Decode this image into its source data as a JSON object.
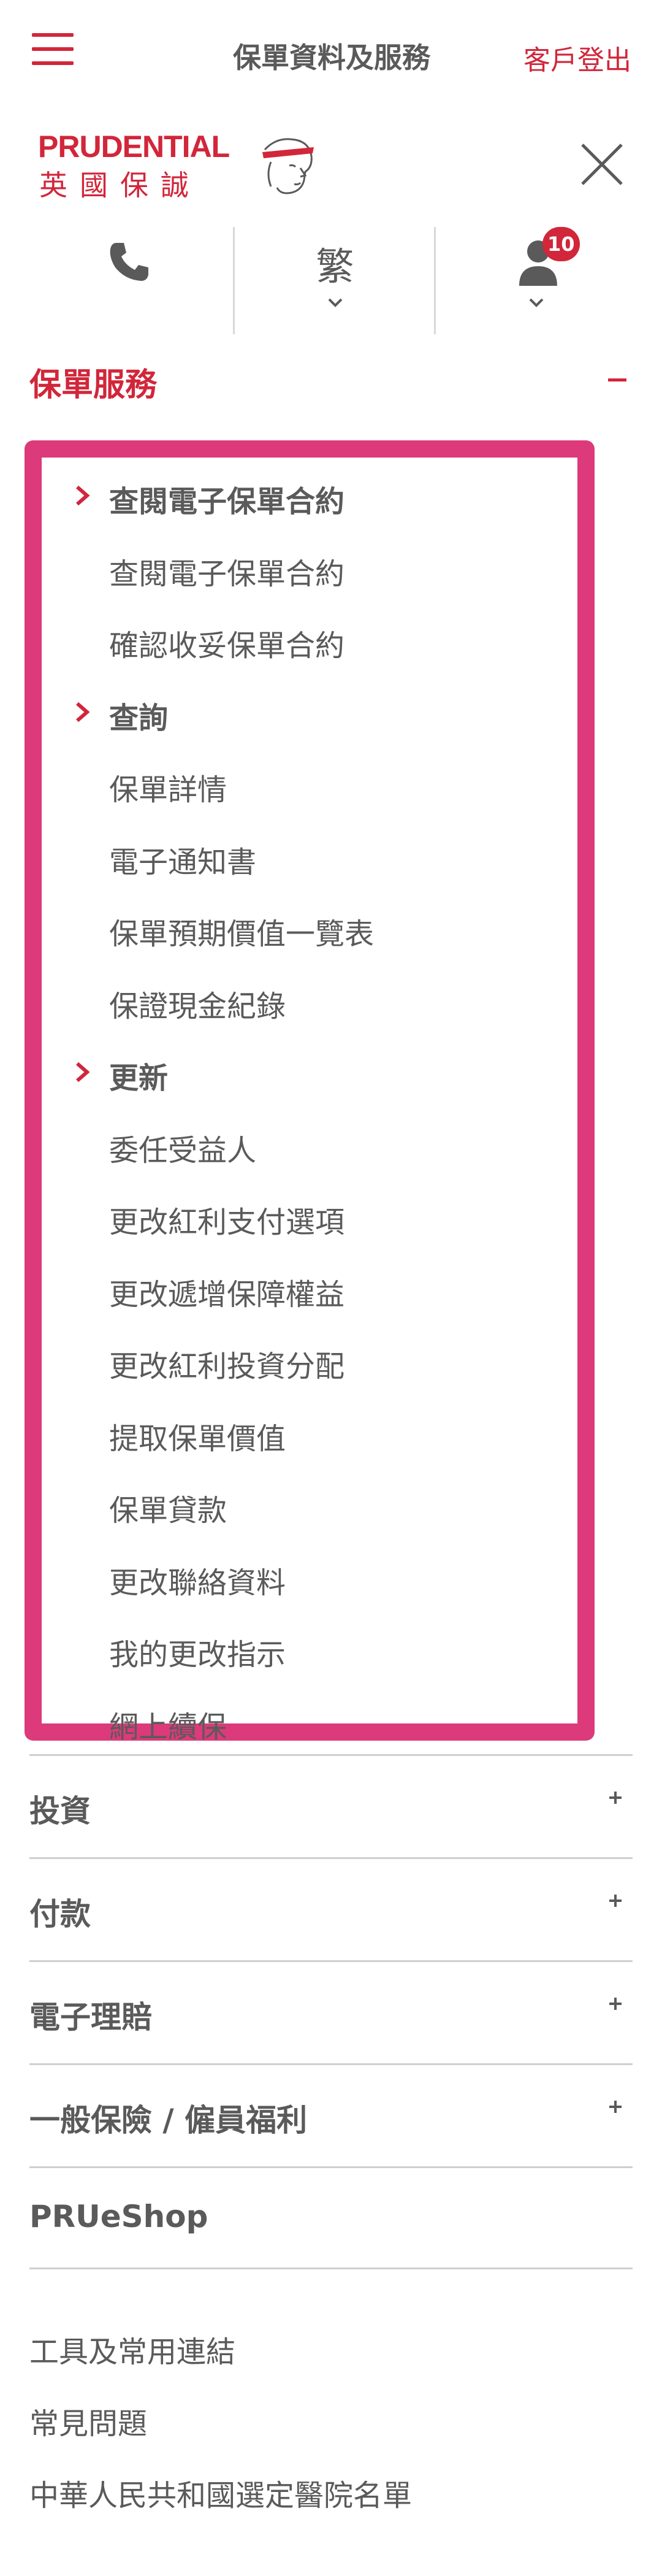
{
  "header": {
    "title": "保單資料及服務",
    "logout_label": "客戶登出"
  },
  "logo": {
    "brand": "PRUDENTIAL",
    "chinese": "英國保誠"
  },
  "quick_actions": {
    "language_label": "繁",
    "notification_count": "10"
  },
  "colors": {
    "brand_red": "#d2263a",
    "highlight_pink": "#dc3a7a",
    "text_gray": "#5a5a5a"
  },
  "policy_services": {
    "title": "保單服務",
    "items": [
      {
        "label": "查閱電子保單合約",
        "group": true
      },
      {
        "label": "查閱電子保單合約",
        "group": false
      },
      {
        "label": "確認收妥保單合約",
        "group": false
      },
      {
        "label": "查詢",
        "group": true
      },
      {
        "label": "保單詳情",
        "group": false
      },
      {
        "label": "電子通知書",
        "group": false
      },
      {
        "label": "保單預期價值一覽表",
        "group": false
      },
      {
        "label": "保證現金紀錄",
        "group": false
      },
      {
        "label": "更新",
        "group": true
      },
      {
        "label": "委任受益人",
        "group": false
      },
      {
        "label": "更改紅利支付選項",
        "group": false
      },
      {
        "label": "更改遞增保障權益",
        "group": false
      },
      {
        "label": "更改紅利投資分配",
        "group": false
      },
      {
        "label": "提取保單價值",
        "group": false
      },
      {
        "label": "保單貸款",
        "group": false
      },
      {
        "label": "更改聯絡資料",
        "group": false
      },
      {
        "label": "我的更改指示",
        "group": false
      },
      {
        "label": "網上續保",
        "group": false
      }
    ]
  },
  "accordion": [
    {
      "label": "投資",
      "expandable": true
    },
    {
      "label": "付款",
      "expandable": true
    },
    {
      "label": "電子理賠",
      "expandable": true
    },
    {
      "label": "一般保險 / 僱員福利",
      "expandable": true
    },
    {
      "label": "PRUeShop",
      "expandable": false
    }
  ],
  "footer_links": [
    "工具及常用連結",
    "常見問題",
    "中華人民共和國選定醫院名單"
  ]
}
